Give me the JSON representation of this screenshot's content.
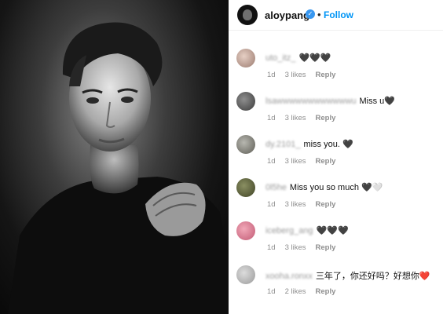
{
  "post": {
    "username": "aloypang",
    "separator": "•",
    "follow_label": "Follow"
  },
  "comments": [
    {
      "user": "uto_itz_",
      "text": "🖤🖤🖤",
      "age": "1d",
      "likes": "3 likes",
      "reply": "Reply"
    },
    {
      "user": "lsawwwwwwwwwwwwu",
      "text": "Miss u🖤",
      "age": "1d",
      "likes": "3 likes",
      "reply": "Reply"
    },
    {
      "user": "dy.2101_",
      "text": "miss you. 🖤",
      "age": "1d",
      "likes": "3 likes",
      "reply": "Reply"
    },
    {
      "user": "0l5he",
      "text": "Miss you so much 🖤🤍",
      "age": "1d",
      "likes": "3 likes",
      "reply": "Reply"
    },
    {
      "user": "iceberg_ang",
      "text": "🖤🖤🖤",
      "age": "1d",
      "likes": "3 likes",
      "reply": "Reply"
    },
    {
      "user": "xooha.ronxx",
      "text": "三年了，你还好吗？好想你❤️",
      "age": "1d",
      "likes": "2 likes",
      "reply": "Reply"
    }
  ]
}
